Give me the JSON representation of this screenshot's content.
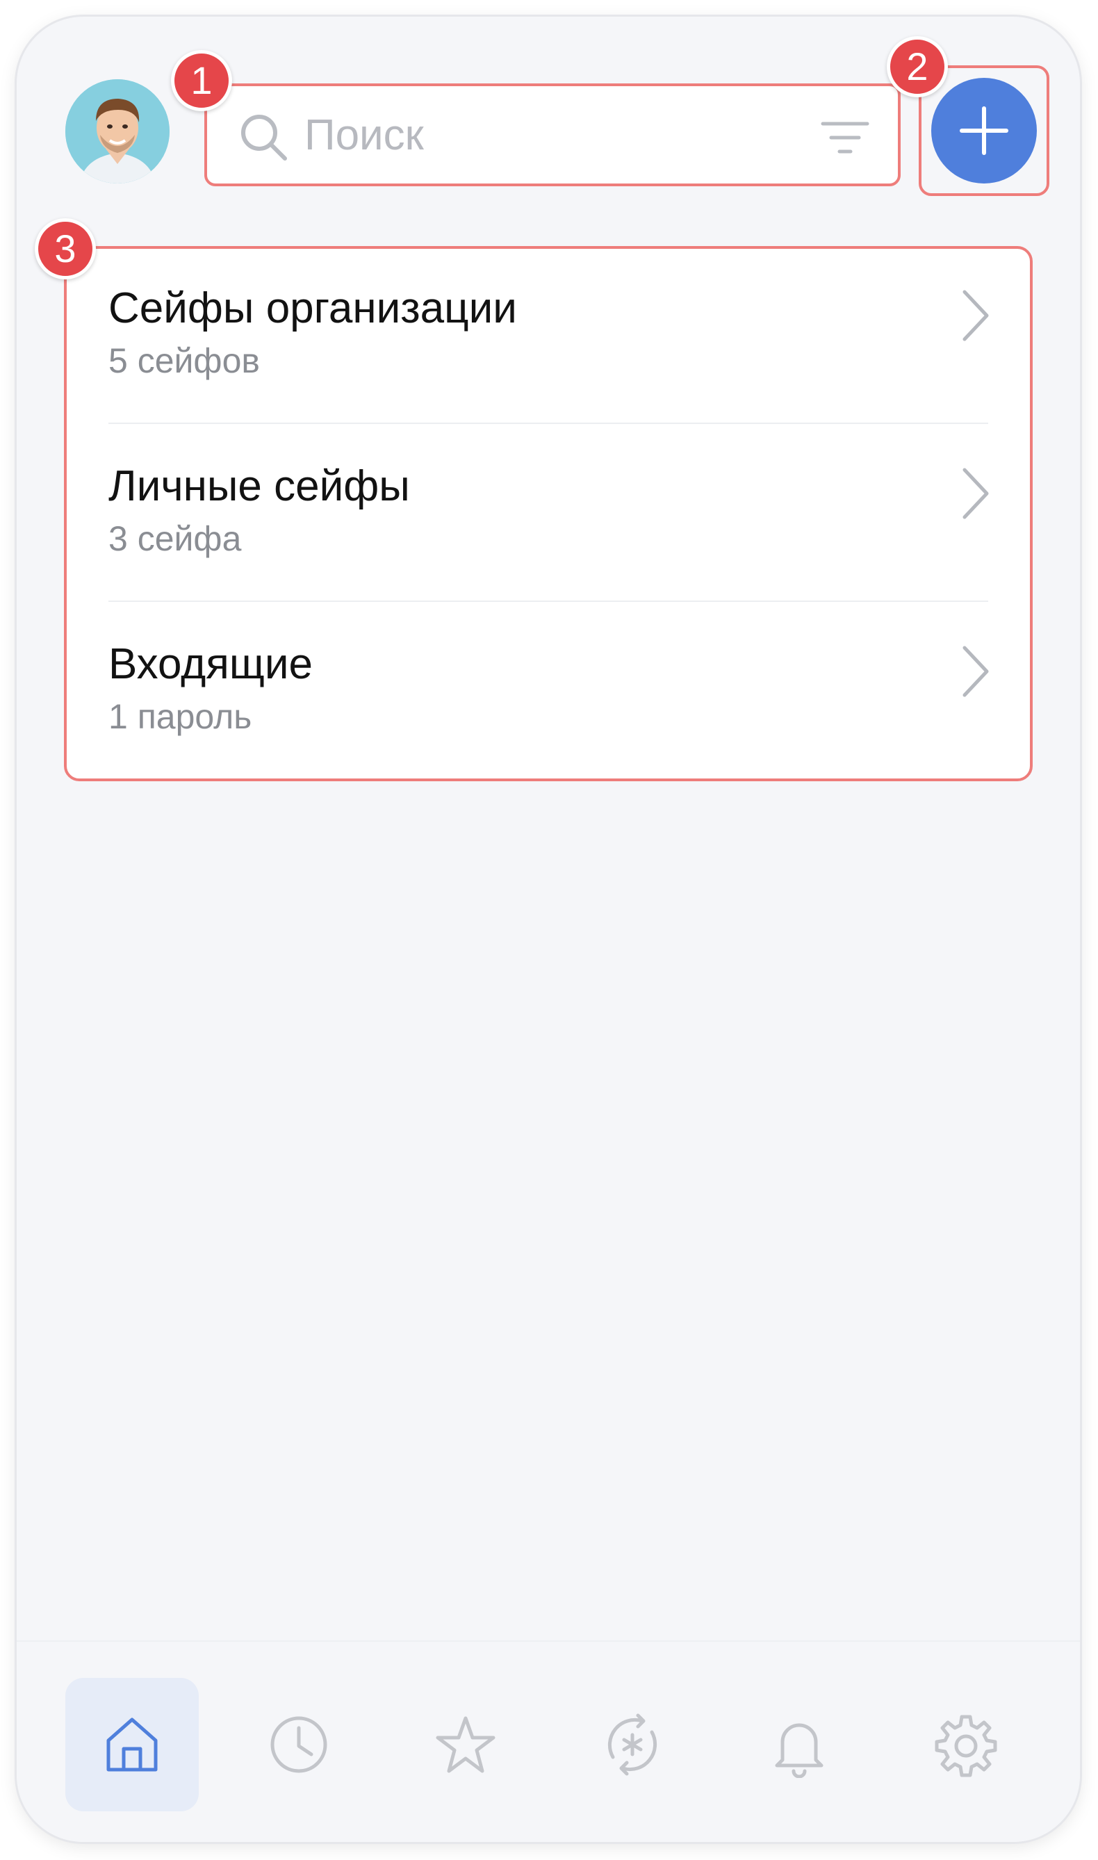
{
  "search": {
    "placeholder": "Поиск"
  },
  "badges": {
    "one": "1",
    "two": "2",
    "three": "3"
  },
  "vaults": [
    {
      "title": "Сейфы организации",
      "subtitle": "5 сейфов"
    },
    {
      "title": "Личные сейфы",
      "subtitle": "3 сейфа"
    },
    {
      "title": "Входящие",
      "subtitle": "1 пароль"
    }
  ],
  "nav": [
    {
      "icon": "home-icon",
      "active": true
    },
    {
      "icon": "clock-icon",
      "active": false
    },
    {
      "icon": "star-icon",
      "active": false
    },
    {
      "icon": "password-generator-icon",
      "active": false
    },
    {
      "icon": "bell-icon",
      "active": false
    },
    {
      "icon": "gear-icon",
      "active": false
    }
  ],
  "colors": {
    "accent": "#4f7fdc",
    "highlight_border": "#ee7d7b",
    "badge": "#e5464a",
    "nav_icon": "#c3c5ca"
  }
}
